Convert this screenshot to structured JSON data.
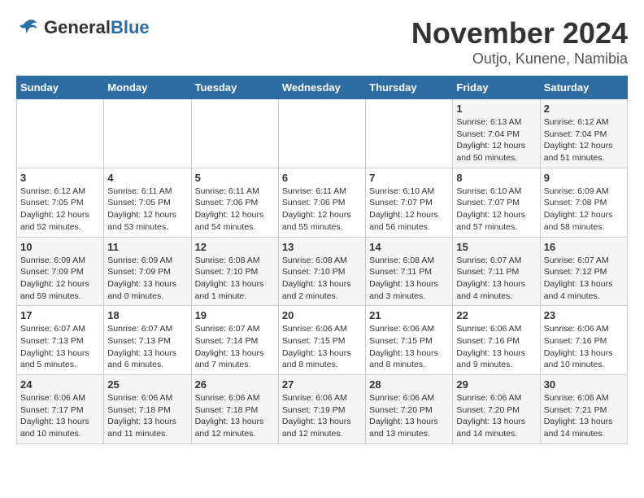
{
  "logo": {
    "general": "General",
    "blue": "Blue"
  },
  "title": "November 2024",
  "location": "Outjo, Kunene, Namibia",
  "weekdays": [
    "Sunday",
    "Monday",
    "Tuesday",
    "Wednesday",
    "Thursday",
    "Friday",
    "Saturday"
  ],
  "weeks": [
    [
      {
        "day": "",
        "info": ""
      },
      {
        "day": "",
        "info": ""
      },
      {
        "day": "",
        "info": ""
      },
      {
        "day": "",
        "info": ""
      },
      {
        "day": "",
        "info": ""
      },
      {
        "day": "1",
        "info": "Sunrise: 6:13 AM\nSunset: 7:04 PM\nDaylight: 12 hours\nand 50 minutes."
      },
      {
        "day": "2",
        "info": "Sunrise: 6:12 AM\nSunset: 7:04 PM\nDaylight: 12 hours\nand 51 minutes."
      }
    ],
    [
      {
        "day": "3",
        "info": "Sunrise: 6:12 AM\nSunset: 7:05 PM\nDaylight: 12 hours\nand 52 minutes."
      },
      {
        "day": "4",
        "info": "Sunrise: 6:11 AM\nSunset: 7:05 PM\nDaylight: 12 hours\nand 53 minutes."
      },
      {
        "day": "5",
        "info": "Sunrise: 6:11 AM\nSunset: 7:06 PM\nDaylight: 12 hours\nand 54 minutes."
      },
      {
        "day": "6",
        "info": "Sunrise: 6:11 AM\nSunset: 7:06 PM\nDaylight: 12 hours\nand 55 minutes."
      },
      {
        "day": "7",
        "info": "Sunrise: 6:10 AM\nSunset: 7:07 PM\nDaylight: 12 hours\nand 56 minutes."
      },
      {
        "day": "8",
        "info": "Sunrise: 6:10 AM\nSunset: 7:07 PM\nDaylight: 12 hours\nand 57 minutes."
      },
      {
        "day": "9",
        "info": "Sunrise: 6:09 AM\nSunset: 7:08 PM\nDaylight: 12 hours\nand 58 minutes."
      }
    ],
    [
      {
        "day": "10",
        "info": "Sunrise: 6:09 AM\nSunset: 7:09 PM\nDaylight: 12 hours\nand 59 minutes."
      },
      {
        "day": "11",
        "info": "Sunrise: 6:09 AM\nSunset: 7:09 PM\nDaylight: 13 hours\nand 0 minutes."
      },
      {
        "day": "12",
        "info": "Sunrise: 6:08 AM\nSunset: 7:10 PM\nDaylight: 13 hours\nand 1 minute."
      },
      {
        "day": "13",
        "info": "Sunrise: 6:08 AM\nSunset: 7:10 PM\nDaylight: 13 hours\nand 2 minutes."
      },
      {
        "day": "14",
        "info": "Sunrise: 6:08 AM\nSunset: 7:11 PM\nDaylight: 13 hours\nand 3 minutes."
      },
      {
        "day": "15",
        "info": "Sunrise: 6:07 AM\nSunset: 7:11 PM\nDaylight: 13 hours\nand 4 minutes."
      },
      {
        "day": "16",
        "info": "Sunrise: 6:07 AM\nSunset: 7:12 PM\nDaylight: 13 hours\nand 4 minutes."
      }
    ],
    [
      {
        "day": "17",
        "info": "Sunrise: 6:07 AM\nSunset: 7:13 PM\nDaylight: 13 hours\nand 5 minutes."
      },
      {
        "day": "18",
        "info": "Sunrise: 6:07 AM\nSunset: 7:13 PM\nDaylight: 13 hours\nand 6 minutes."
      },
      {
        "day": "19",
        "info": "Sunrise: 6:07 AM\nSunset: 7:14 PM\nDaylight: 13 hours\nand 7 minutes."
      },
      {
        "day": "20",
        "info": "Sunrise: 6:06 AM\nSunset: 7:15 PM\nDaylight: 13 hours\nand 8 minutes."
      },
      {
        "day": "21",
        "info": "Sunrise: 6:06 AM\nSunset: 7:15 PM\nDaylight: 13 hours\nand 8 minutes."
      },
      {
        "day": "22",
        "info": "Sunrise: 6:06 AM\nSunset: 7:16 PM\nDaylight: 13 hours\nand 9 minutes."
      },
      {
        "day": "23",
        "info": "Sunrise: 6:06 AM\nSunset: 7:16 PM\nDaylight: 13 hours\nand 10 minutes."
      }
    ],
    [
      {
        "day": "24",
        "info": "Sunrise: 6:06 AM\nSunset: 7:17 PM\nDaylight: 13 hours\nand 10 minutes."
      },
      {
        "day": "25",
        "info": "Sunrise: 6:06 AM\nSunset: 7:18 PM\nDaylight: 13 hours\nand 11 minutes."
      },
      {
        "day": "26",
        "info": "Sunrise: 6:06 AM\nSunset: 7:18 PM\nDaylight: 13 hours\nand 12 minutes."
      },
      {
        "day": "27",
        "info": "Sunrise: 6:06 AM\nSunset: 7:19 PM\nDaylight: 13 hours\nand 12 minutes."
      },
      {
        "day": "28",
        "info": "Sunrise: 6:06 AM\nSunset: 7:20 PM\nDaylight: 13 hours\nand 13 minutes."
      },
      {
        "day": "29",
        "info": "Sunrise: 6:06 AM\nSunset: 7:20 PM\nDaylight: 13 hours\nand 14 minutes."
      },
      {
        "day": "30",
        "info": "Sunrise: 6:06 AM\nSunset: 7:21 PM\nDaylight: 13 hours\nand 14 minutes."
      }
    ]
  ]
}
